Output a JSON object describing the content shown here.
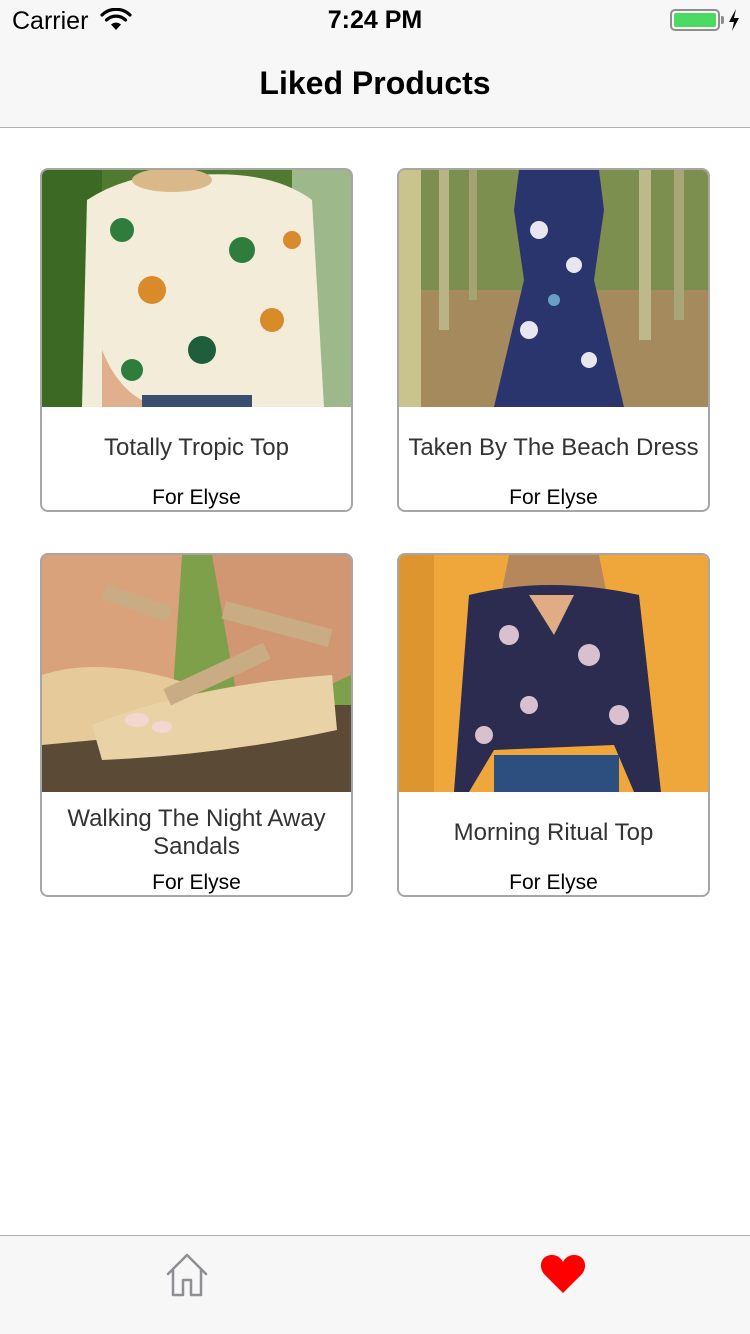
{
  "status_bar": {
    "carrier": "Carrier",
    "time": "7:24 PM",
    "battery_percent": 100
  },
  "nav": {
    "title": "Liked Products"
  },
  "products": [
    {
      "name": "Totally Tropic Top",
      "for_label": "For Elyse",
      "image": "floral-cream-top-photo"
    },
    {
      "name": "Taken By The Beach Dress",
      "for_label": "For Elyse",
      "image": "navy-floral-dress-photo"
    },
    {
      "name": "Walking The Night Away Sandals",
      "for_label": "For Elyse",
      "image": "tan-wedge-sandals-photo"
    },
    {
      "name": "Morning Ritual Top",
      "for_label": "For Elyse",
      "image": "navy-floral-blouse-photo"
    }
  ],
  "tab_bar": {
    "items": [
      {
        "icon": "home-icon",
        "selected": false
      },
      {
        "icon": "heart-icon",
        "selected": true
      }
    ],
    "accent_color": "#ff0000",
    "inactive_color": "#8e8e93"
  }
}
